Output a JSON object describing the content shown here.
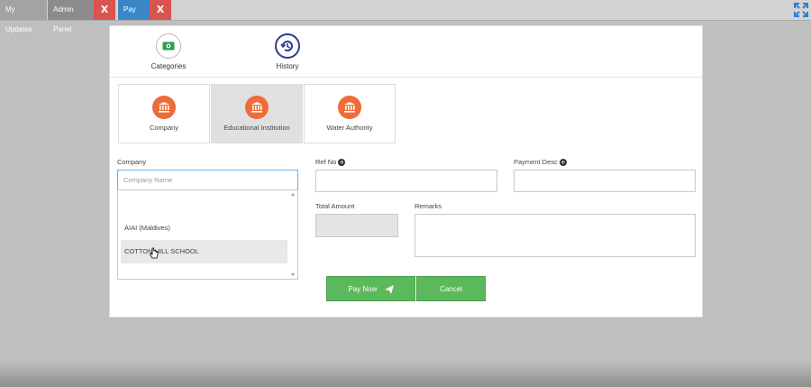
{
  "tabs": [
    {
      "label": "My Updates",
      "color": "#a3a3a3"
    },
    {
      "label": "Admin Panel",
      "color": "#8c8c8c"
    },
    {
      "label": "Pay",
      "color": "#3b86c7"
    }
  ],
  "tab_close_label": "X",
  "colors": {
    "accent_green": "#5cb85c",
    "category_orange": "#ee6b3a",
    "tab_close_red": "#d9534f",
    "nav_blue": "#2d3e8f"
  },
  "nav": {
    "categories": {
      "label": "Categories",
      "icon": "money-icon"
    },
    "history": {
      "label": "History",
      "icon": "history-icon"
    }
  },
  "categories": [
    {
      "label": "Company",
      "icon": "bank-icon"
    },
    {
      "label": "Educational Institution",
      "icon": "bank-icon",
      "selected": true
    },
    {
      "label": "Water Authority",
      "icon": "bank-icon"
    }
  ],
  "form": {
    "company_label": "Company",
    "company_placeholder": "Company Name",
    "company_options": [
      "AIAI (Maldives)",
      "COTTON HILL SCHOOL"
    ],
    "ref_no_label": "Ref No",
    "payment_desc_label": "Payment Desc",
    "total_amount_label": "Total Amount",
    "remarks_label": "Remarks"
  },
  "buttons": {
    "pay_now": "Pay Now",
    "cancel": "Cancel"
  }
}
